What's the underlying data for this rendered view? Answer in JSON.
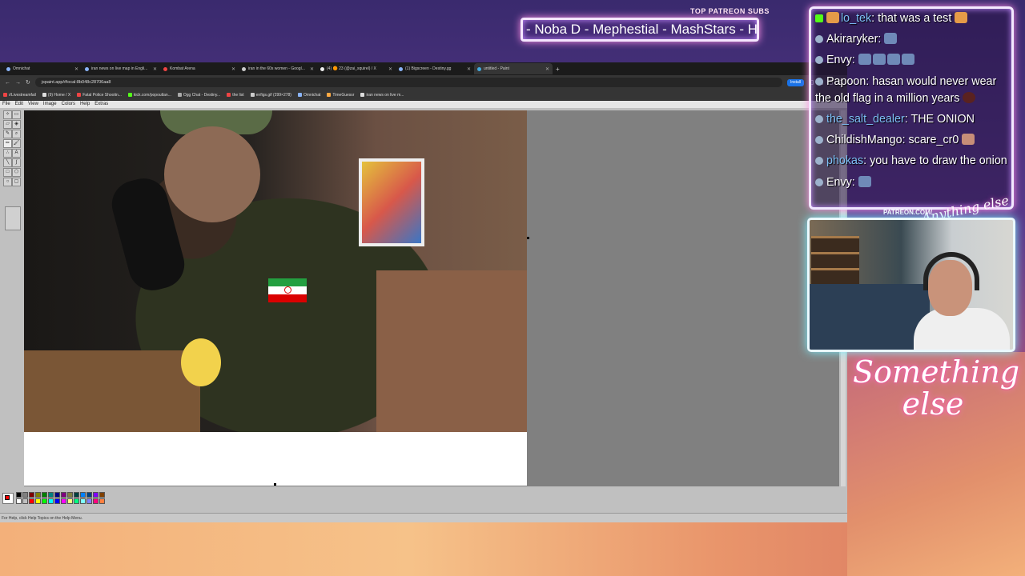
{
  "ticker": {
    "label": "TOP PATREON SUBS",
    "text": "- Noba D - Mephestial - MashStars - H"
  },
  "browser": {
    "tabs": [
      {
        "label": "Omnichat"
      },
      {
        "label": "iran news on live map in Engli..."
      },
      {
        "label": "Kombat Arena"
      },
      {
        "label": "iran in the 60s women - Googl..."
      },
      {
        "label": "(4) 🟠 23 (@zai_squirel) / X"
      },
      {
        "label": "(1) Bigscreen - Destiny.gg"
      },
      {
        "label": "untitled - Paint"
      }
    ],
    "url": "jspaint.app/#local:8b048c28706aa8",
    "install_label": "Install",
    "bookmarks": [
      "r/Livestreamfail",
      "(9) Home / X",
      "Fatal Police Shootin...",
      "kick.com/popoutlan...",
      "Ogg Chat - Destiny...",
      "the list",
      "enfigs.gif (299×278)",
      "Omnichat",
      "TimeGuessr",
      "iran news on live m..."
    ]
  },
  "paint": {
    "menu": [
      "File",
      "Edit",
      "View",
      "Image",
      "Colors",
      "Help",
      "Extras"
    ],
    "status": "For Help, click Help Topics on the Help Menu.",
    "palette": [
      "#000000",
      "#808080",
      "#800000",
      "#808000",
      "#008000",
      "#008080",
      "#000080",
      "#800080",
      "#808040",
      "#004040",
      "#0080ff",
      "#004080",
      "#8000ff",
      "#804000",
      "#ffffff",
      "#c0c0c0",
      "#ff0000",
      "#ffff00",
      "#00ff00",
      "#00ffff",
      "#0000ff",
      "#ff00ff",
      "#ffff80",
      "#00ff80",
      "#80ffff",
      "#8080ff",
      "#ff0080",
      "#ff8040"
    ],
    "foreground": "#ff0000",
    "background": "#ffffff"
  },
  "chat": {
    "messages": [
      {
        "user": "lo_tek",
        "text": "that was a test",
        "badge": "kick",
        "emote_after": "orange"
      },
      {
        "user": "Akiraryker",
        "text": "",
        "badge": "bot",
        "emotes": 1
      },
      {
        "user": "Envy",
        "text": "",
        "badge": "bot",
        "emotes": 4
      },
      {
        "user": "Papoon",
        "text": "hasan would never wear the old flag in a million years",
        "badge": "bot",
        "emote_after": "dark"
      },
      {
        "user": "the_salt_dealer",
        "text": "THE ONION",
        "badge": "bot",
        "blue": true
      },
      {
        "user": "ChildishMango",
        "text": "scare_cr0",
        "badge": "bot",
        "emote_after": "face"
      },
      {
        "user": "phokas",
        "text": "you have to draw the onion",
        "badge": "bot",
        "blue": true
      },
      {
        "user": "Envy",
        "text": "",
        "badge": "bot",
        "emotes": 1
      }
    ]
  },
  "overlay": {
    "patreon_url": "PATREON.COM/",
    "brand_small": "Anything else",
    "brand": "Something else"
  }
}
